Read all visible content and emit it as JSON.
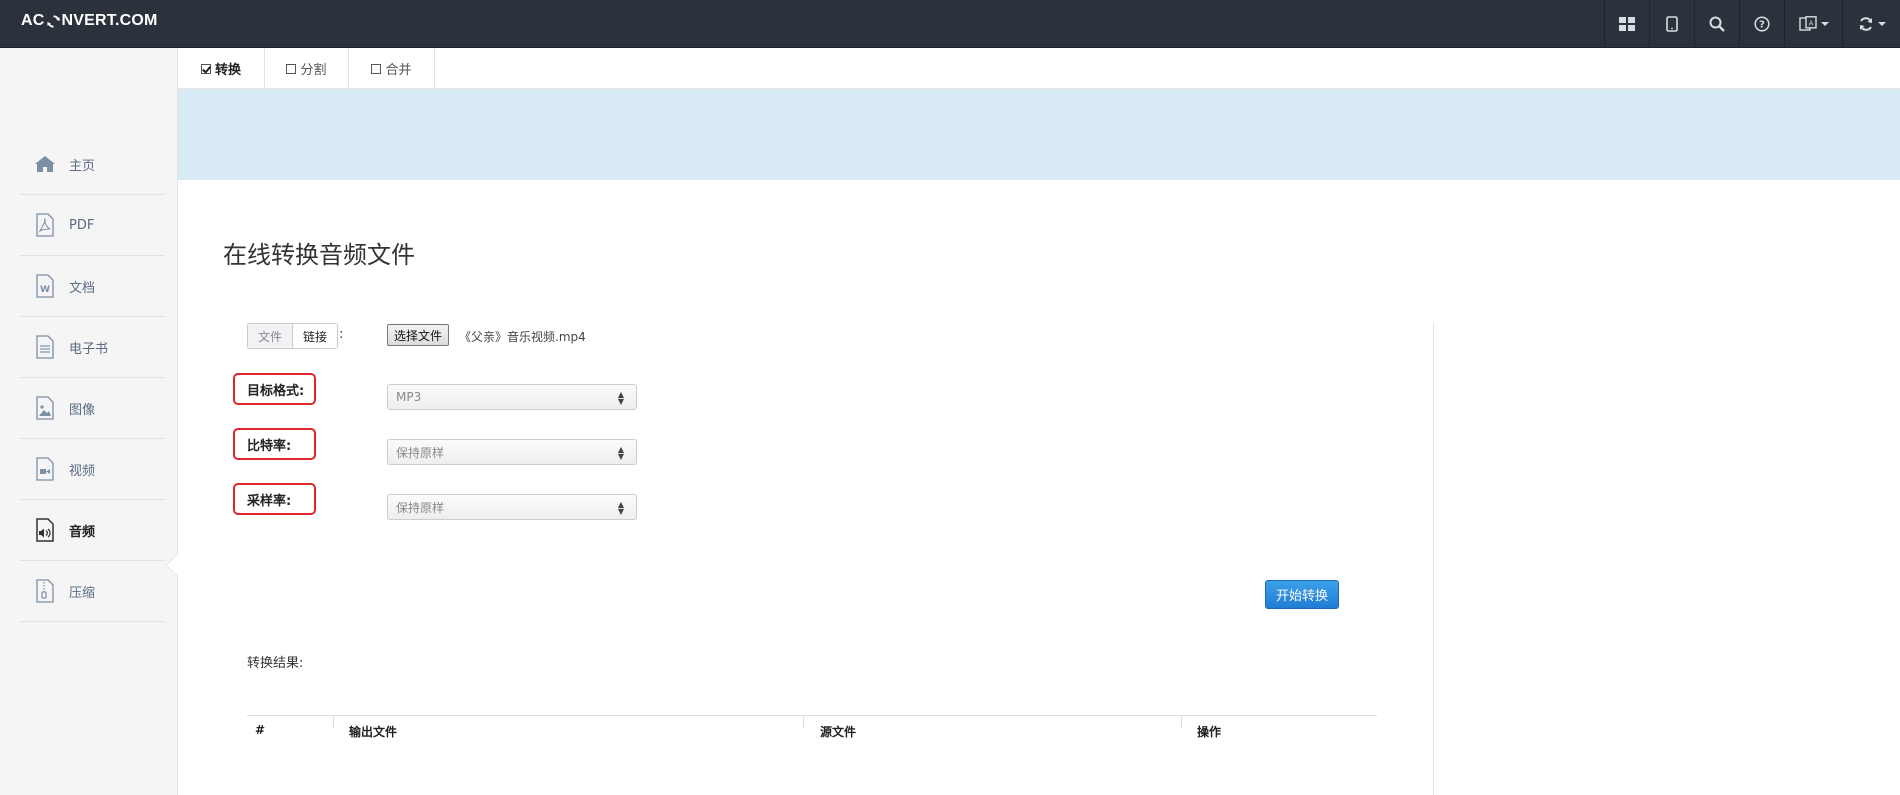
{
  "app": {
    "logo_prefix": "AC",
    "logo_suffix": "NVERT.COM"
  },
  "topbar": {
    "icons": [
      "apps-grid-icon",
      "tablet-icon",
      "search-icon",
      "help-icon",
      "language-icon",
      "refresh-icon"
    ]
  },
  "sidebar": {
    "items": [
      {
        "label": "主页",
        "icon": "home-icon"
      },
      {
        "label": "PDF",
        "icon": "pdf-file-icon"
      },
      {
        "label": "文档",
        "icon": "word-file-icon"
      },
      {
        "label": "电子书",
        "icon": "ebook-file-icon"
      },
      {
        "label": "图像",
        "icon": "image-file-icon"
      },
      {
        "label": "视频",
        "icon": "video-file-icon"
      },
      {
        "label": "音频",
        "icon": "audio-file-icon",
        "active": true
      },
      {
        "label": "压缩",
        "icon": "archive-file-icon"
      }
    ]
  },
  "tabs": [
    {
      "label": "转换",
      "checked": true
    },
    {
      "label": "分割",
      "checked": false
    },
    {
      "label": "合并",
      "checked": false
    }
  ],
  "main": {
    "title": "在线转换音频文件",
    "source_toggle": {
      "file": "文件",
      "link": "链接",
      "colon": ":"
    },
    "file_button": "选择文件",
    "file_name": "《父亲》音乐视频.mp4",
    "fields": [
      {
        "label": "目标格式:",
        "value": "MP3"
      },
      {
        "label": "比特率:",
        "value": "保持原样"
      },
      {
        "label": "采样率:",
        "value": "保持原样"
      }
    ],
    "start_button": "开始转换",
    "result_label": "转换结果:",
    "table_headers": [
      "#",
      "输出文件",
      "源文件",
      "操作"
    ]
  },
  "colors": {
    "topbar": "#2b323b",
    "banner": "#d8eaf4",
    "highlight_border": "#e0262b",
    "primary_button": "#1f7dd3"
  }
}
